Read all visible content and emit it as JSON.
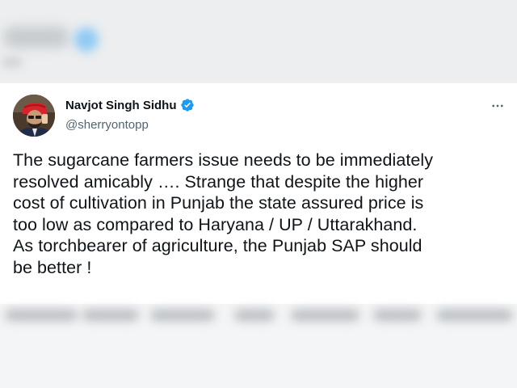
{
  "tweet": {
    "author": {
      "display_name": "Navjot Singh Sidhu",
      "handle": "@sherryontopp",
      "verified": true
    },
    "more_icon": "more-horizontal-icon",
    "text_lines": [
      "The sugarcane farmers issue needs to be immediately",
      "resolved amicably …. Strange that despite the higher",
      "cost of cultivation in Punjab the state assured price is",
      "too low as compared to Haryana / UP / Uttarakhand.",
      "As torchbearer of agriculture, the Punjab SAP should",
      "be better !"
    ]
  },
  "colors": {
    "text_primary": "#0f1419",
    "text_secondary": "#536471",
    "verified_blue": "#1d9bf0",
    "card_bg": "#ffffff",
    "page_bg": "#f2f3f4"
  }
}
